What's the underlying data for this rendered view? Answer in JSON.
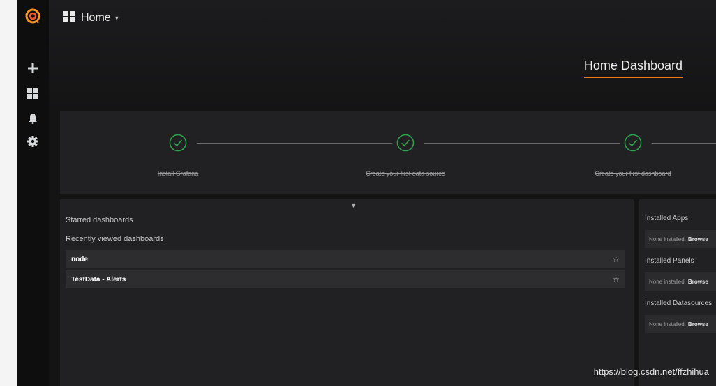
{
  "colors": {
    "accent": "#eb7b18",
    "success": "#2ea24c",
    "panel": "#212124",
    "sidebar": "#0e0e0f"
  },
  "sidebar": {
    "logo_icon": "grafana-logo-icon",
    "items": [
      {
        "icon": "plus-icon"
      },
      {
        "icon": "dashboards-grid-icon"
      },
      {
        "icon": "bell-icon"
      },
      {
        "icon": "gear-icon"
      }
    ]
  },
  "header": {
    "title": "Home",
    "dashboard_title": "Home Dashboard"
  },
  "steps": [
    {
      "label": "Install Grafana",
      "done": true
    },
    {
      "label": "Create your first data source",
      "done": true
    },
    {
      "label": "Create your first dashboard",
      "done": true
    }
  ],
  "dashboards": {
    "starred_label": "Starred dashboards",
    "recent_label": "Recently viewed dashboards",
    "recent": [
      {
        "name": "node"
      },
      {
        "name": "TestData - Alerts"
      }
    ]
  },
  "plugins": {
    "apps_label": "Installed Apps",
    "panels_label": "Installed Panels",
    "datasources_label": "Installed Datasources",
    "none_text": "None installed.",
    "browse_text": "Browse"
  },
  "watermark": "https://blog.csdn.net/ffzhihua"
}
